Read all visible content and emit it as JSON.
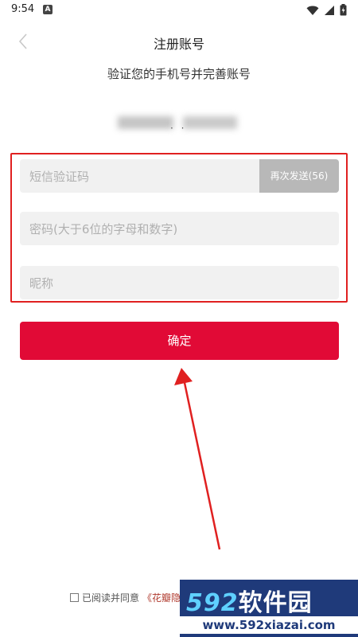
{
  "status_bar": {
    "time": "9:54",
    "notification_badge": "A"
  },
  "header": {
    "title": "注册账号",
    "back_icon": "chevron-left-icon"
  },
  "subtitle": "验证您的手机号并完善账号",
  "phone": {
    "masked_display": "· ·"
  },
  "form": {
    "sms_code": {
      "placeholder": "短信验证码",
      "value": ""
    },
    "resend_button": "再次发送(56)",
    "password": {
      "placeholder": "密码(大于6位的字母和数字)",
      "value": ""
    },
    "nickname": {
      "placeholder": "昵称",
      "value": ""
    },
    "confirm_button": "确定"
  },
  "agreement": {
    "text": "已阅读并同意",
    "link": "《花瓣隐"
  },
  "watermark": {
    "brand_num": "592",
    "brand_text": "软件园",
    "url": "www.592xiazai.com"
  },
  "colors": {
    "accent": "#e10a36",
    "highlight_frame": "#e02020",
    "resend_bg": "#b8b8b8",
    "field_bg": "#f1f1f1"
  }
}
